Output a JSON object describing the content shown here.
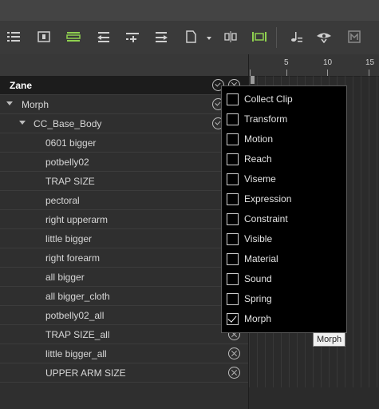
{
  "toolbar": {
    "icons": [
      "list-icon",
      "frame-icon",
      "track-rows-icon",
      "collapse-left-icon",
      "add-key-icon",
      "expand-right-icon",
      "page-icon",
      "split-icon",
      "clip-icon",
      "music-note-icon",
      "eye-audio-icon",
      "motion-clip-icon"
    ],
    "accent": "#8fd14f"
  },
  "ruler": {
    "labels": [
      "5",
      "10",
      "15"
    ]
  },
  "tree": {
    "root": "Zane",
    "group": "Morph",
    "subgroup": "CC_Base_Body",
    "items": [
      "0601 bigger",
      "potbelly02",
      "TRAP SIZE",
      "pectoral",
      "right upperarm",
      "little bigger",
      "right forearm",
      "all bigger",
      "all bigger_cloth",
      "potbelly02_all",
      "TRAP SIZE_all",
      "little bigger_all",
      "UPPER ARM SIZE"
    ]
  },
  "menu": {
    "items": [
      {
        "label": "Collect Clip",
        "checked": false
      },
      {
        "label": "Transform",
        "checked": false
      },
      {
        "label": "Motion",
        "checked": false
      },
      {
        "label": "Reach",
        "checked": false
      },
      {
        "label": "Viseme",
        "checked": false
      },
      {
        "label": "Expression",
        "checked": false
      },
      {
        "label": "Constraint",
        "checked": false
      },
      {
        "label": "Visible",
        "checked": false
      },
      {
        "label": "Material",
        "checked": false
      },
      {
        "label": "Sound",
        "checked": false
      },
      {
        "label": "Spring",
        "checked": false
      },
      {
        "label": "Morph",
        "checked": true
      }
    ]
  },
  "tooltip": "Morph"
}
